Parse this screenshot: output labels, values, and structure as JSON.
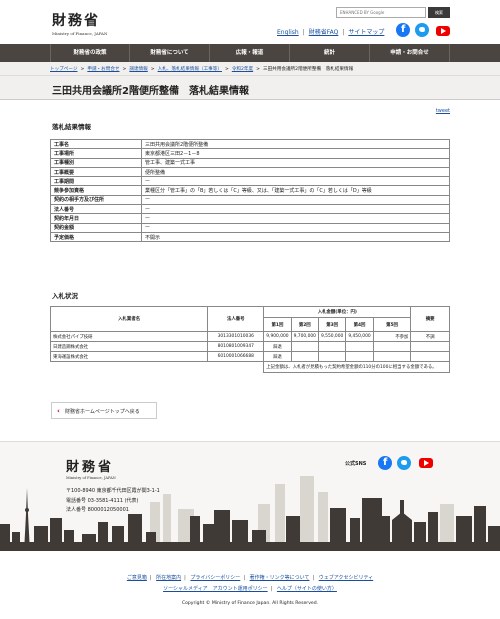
{
  "header": {
    "logo_kanji": "財務省",
    "logo_en": "Ministry of Finance, JAPAN",
    "search_placeholder": "ENHANCED BY Google",
    "search_button": "検索",
    "top_links": [
      "English",
      "財務省FAQ",
      "サイトマップ"
    ]
  },
  "nav": [
    "財務省の政策",
    "財務省について",
    "広報・報道",
    "統計",
    "申請・お問合せ"
  ],
  "breadcrumb": {
    "links": [
      "トップページ",
      "申請・お問合せ",
      "調達情報",
      "入札、落札結果情報（工事等）",
      "令和2年度"
    ],
    "current": "三田共用会議所2階便所整備　落札結果情報"
  },
  "page_title": "三田共用会議所2階便所整備　落札結果情報",
  "tweet_label": "tweet",
  "info_section": {
    "title": "落札結果情報",
    "rows": [
      {
        "label": "工事名",
        "value": "三田共用会議所2階便所整備"
      },
      {
        "label": "工事場所",
        "value": "東京都港区三田2－1－8"
      },
      {
        "label": "工事種別",
        "value": "管工事、建築一式工事"
      },
      {
        "label": "工事概要",
        "value": "便所整備"
      },
      {
        "label": "工事期間",
        "value": "ー"
      },
      {
        "label": "競争参加資格",
        "value": "業種区分「管工事」の「B」若しくは「C」等級、又は、「建築一式工事」の「C」若しくは「D」等級"
      },
      {
        "label": "契約の相手方及び住所",
        "value": "ー"
      },
      {
        "label": "法人番号",
        "value": "ー"
      },
      {
        "label": "契約年月日",
        "value": "ー"
      },
      {
        "label": "契約金額",
        "value": "ー"
      },
      {
        "label": "予定価格",
        "value": "不開示"
      }
    ]
  },
  "bid_section": {
    "title": "入札状況",
    "headers": {
      "bidder": "入札業者名",
      "corp_no": "法人番号",
      "amount": "入札金額(単位：円)",
      "remarks": "摘要",
      "rounds": [
        "第1回",
        "第2回",
        "第3回",
        "第4回",
        "第5回"
      ]
    },
    "rows": [
      {
        "name": "株式会社パイプ技研",
        "corp_no": "3013301010036",
        "r1": "9,900,000",
        "r2": "9,700,000",
        "r3": "9,550,000",
        "r4": "9,450,000",
        "r5": "不参加",
        "remarks": "不調"
      },
      {
        "name": "日建造鋼株式会社",
        "corp_no": "8010801009347",
        "r1": "辞退",
        "r2": "",
        "r3": "",
        "r4": "",
        "r5": "",
        "remarks": ""
      },
      {
        "name": "東海運設株式会社",
        "corp_no": "6010001066688",
        "r1": "辞退",
        "r2": "",
        "r3": "",
        "r4": "",
        "r5": "",
        "remarks": ""
      }
    ],
    "note": "上記金額は、入札者が見積もった契約希望金額の110分の100に相当する金額である。"
  },
  "back_link": "財務省ホームページトップへ戻る",
  "footer": {
    "logo_kanji": "財務省",
    "logo_en": "Ministry of Finance, JAPAN",
    "sns_label": "公式SNS",
    "address": "〒100-8940 東京都千代田区霞が関3-1-1",
    "phone": "電話番号 03-3581-4111 (代表)",
    "corp_no": "法人番号 8000012050001",
    "links_row1": [
      "ご意見箱",
      "所在地案内",
      "プライバシーポリシー",
      "著作権・リンク等について",
      "ウェブアクセシビリティ"
    ],
    "links_row2": [
      "ソーシャルメディア　アカウント運用ポリシー",
      "ヘルプ（サイトの使い方）"
    ],
    "copyright": "Copyright © Ministry of Finance Japan. All Rights Reserved."
  },
  "colors": {
    "nav_bg": "#4a4540",
    "link": "#1a4fa0",
    "accent_red": "#cc0000",
    "facebook": "#1877f2",
    "twitter": "#1d9bf0",
    "youtube": "#ee0000"
  },
  "icons": [
    "facebook-icon",
    "twitter-icon",
    "youtube-icon",
    "chevron-left-icon"
  ]
}
